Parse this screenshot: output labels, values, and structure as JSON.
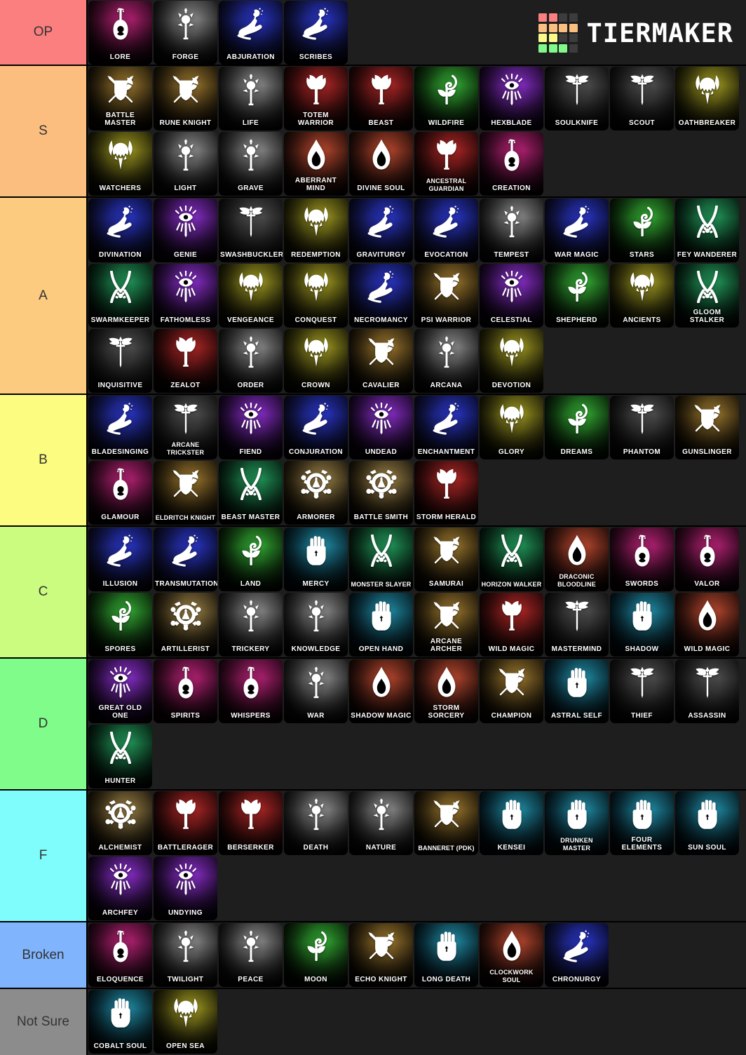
{
  "brand": {
    "name": "TIERMAKER",
    "logo_colors": [
      "#f98080",
      "#f98080",
      "#3c3c3c",
      "#3c3c3c",
      "#f9bf80",
      "#f9bf80",
      "#f9bf80",
      "#f9bf80",
      "#faf98a",
      "#faf98a",
      "#3c3c3c",
      "#3c3c3c",
      "#80f98a",
      "#80f98a",
      "#80f98a",
      "#3c3c3c"
    ]
  },
  "tiers": [
    {
      "label": "OP",
      "color": "#fc7f80",
      "items": [
        {
          "name": "Lore",
          "icon": "lute-icon",
          "c1": "#a31f69",
          "c2": "#1b0510"
        },
        {
          "name": "Forge",
          "icon": "mace-icon",
          "c1": "#7d7d7d",
          "c2": "#101010"
        },
        {
          "name": "Abjuration",
          "icon": "hand-icon",
          "c1": "#2631b4",
          "c2": "#0a0a1c"
        },
        {
          "name": "Scribes",
          "icon": "hand-icon",
          "c1": "#2631b4",
          "c2": "#0a0a1c"
        }
      ]
    },
    {
      "label": "S",
      "color": "#fcbe7f",
      "items": [
        {
          "name": "Battle Master",
          "icon": "shield-axe-icon",
          "c1": "#8a6a2a",
          "c2": "#120d04"
        },
        {
          "name": "Rune Knight",
          "icon": "shield-axe-icon",
          "c1": "#8a6a2a",
          "c2": "#120d04"
        },
        {
          "name": "Life",
          "icon": "mace-icon",
          "c1": "#7d7d7d",
          "c2": "#101010"
        },
        {
          "name": "Totem Warrior",
          "icon": "axe-icon",
          "c1": "#9e2323",
          "c2": "#140404"
        },
        {
          "name": "Beast",
          "icon": "axe-icon",
          "c1": "#9e2323",
          "c2": "#140404"
        },
        {
          "name": "Wildfire",
          "icon": "leaf-icon",
          "c1": "#2f9b2f",
          "c2": "#041204"
        },
        {
          "name": "Hexblade",
          "icon": "eye-icon",
          "c1": "#7b2ab5",
          "c2": "#0f0418"
        },
        {
          "name": "Soulknife",
          "icon": "dagger-icon",
          "c1": "#4a4a4a",
          "c2": "#0c0c0c"
        },
        {
          "name": "Scout",
          "icon": "dagger-icon",
          "c1": "#4a4a4a",
          "c2": "#0c0c0c"
        },
        {
          "name": "Oathbreaker",
          "icon": "helm-icon",
          "c1": "#8f8a1f",
          "c2": "#131204"
        },
        {
          "name": "Watchers",
          "icon": "helm-icon",
          "c1": "#8f8a1f",
          "c2": "#131204"
        },
        {
          "name": "Light",
          "icon": "mace-icon",
          "c1": "#7d7d7d",
          "c2": "#101010"
        },
        {
          "name": "Grave",
          "icon": "mace-icon",
          "c1": "#7d7d7d",
          "c2": "#101010"
        },
        {
          "name": "Aberrant Mind",
          "icon": "flame-icon",
          "c1": "#a3402a",
          "c2": "#160806"
        },
        {
          "name": "Divine Soul",
          "icon": "flame-icon",
          "c1": "#a3402a",
          "c2": "#160806"
        },
        {
          "name": "Ancestral Guardian",
          "icon": "axe-icon",
          "c1": "#9e2323",
          "c2": "#140404"
        },
        {
          "name": "Creation",
          "icon": "lute-icon",
          "c1": "#a31f69",
          "c2": "#1b0510"
        }
      ]
    },
    {
      "label": "A",
      "color": "#fccb80",
      "items": [
        {
          "name": "Divination",
          "icon": "hand-icon",
          "c1": "#2631b4",
          "c2": "#0a0a1c"
        },
        {
          "name": "Genie",
          "icon": "eye-icon",
          "c1": "#7b2ab5",
          "c2": "#0f0418"
        },
        {
          "name": "Swashbuckler",
          "icon": "dagger-icon",
          "c1": "#4a4a4a",
          "c2": "#0c0c0c"
        },
        {
          "name": "Redemption",
          "icon": "helm-icon",
          "c1": "#8f8a1f",
          "c2": "#131204"
        },
        {
          "name": "Graviturgy",
          "icon": "hand-icon",
          "c1": "#2631b4",
          "c2": "#0a0a1c"
        },
        {
          "name": "Evocation",
          "icon": "hand-icon",
          "c1": "#2631b4",
          "c2": "#0a0a1c"
        },
        {
          "name": "Tempest",
          "icon": "mace-icon",
          "c1": "#7d7d7d",
          "c2": "#101010"
        },
        {
          "name": "War Magic",
          "icon": "hand-icon",
          "c1": "#2631b4",
          "c2": "#0a0a1c"
        },
        {
          "name": "Stars",
          "icon": "leaf-icon",
          "c1": "#2f9b2f",
          "c2": "#041204"
        },
        {
          "name": "Fey Wanderer",
          "icon": "bow-icon",
          "c1": "#1f8a52",
          "c2": "#03120a"
        },
        {
          "name": "Swarmkeeper",
          "icon": "bow-icon",
          "c1": "#1f8a52",
          "c2": "#03120a"
        },
        {
          "name": "Fathomless",
          "icon": "eye-icon",
          "c1": "#7b2ab5",
          "c2": "#0f0418"
        },
        {
          "name": "Vengeance",
          "icon": "helm-icon",
          "c1": "#8f8a1f",
          "c2": "#131204"
        },
        {
          "name": "Conquest",
          "icon": "helm-icon",
          "c1": "#8f8a1f",
          "c2": "#131204"
        },
        {
          "name": "Necromancy",
          "icon": "hand-icon",
          "c1": "#2631b4",
          "c2": "#0a0a1c"
        },
        {
          "name": "Psi Warrior",
          "icon": "shield-axe-icon",
          "c1": "#8a6a2a",
          "c2": "#120d04"
        },
        {
          "name": "Celestial",
          "icon": "eye-icon",
          "c1": "#7b2ab5",
          "c2": "#0f0418"
        },
        {
          "name": "Shepherd",
          "icon": "leaf-icon",
          "c1": "#2f9b2f",
          "c2": "#041204"
        },
        {
          "name": "Ancients",
          "icon": "helm-icon",
          "c1": "#8f8a1f",
          "c2": "#131204"
        },
        {
          "name": "Gloom Stalker",
          "icon": "bow-icon",
          "c1": "#1f8a52",
          "c2": "#03120a"
        },
        {
          "name": "Inquisitive",
          "icon": "dagger-icon",
          "c1": "#4a4a4a",
          "c2": "#0c0c0c"
        },
        {
          "name": "Zealot",
          "icon": "axe-icon",
          "c1": "#9e2323",
          "c2": "#140404"
        },
        {
          "name": "Order",
          "icon": "mace-icon",
          "c1": "#7d7d7d",
          "c2": "#101010"
        },
        {
          "name": "Crown",
          "icon": "helm-icon",
          "c1": "#8f8a1f",
          "c2": "#131204"
        },
        {
          "name": "Cavalier",
          "icon": "shield-axe-icon",
          "c1": "#8a6a2a",
          "c2": "#120d04"
        },
        {
          "name": "Arcana",
          "icon": "mace-icon",
          "c1": "#7d7d7d",
          "c2": "#101010"
        },
        {
          "name": "Devotion",
          "icon": "helm-icon",
          "c1": "#8f8a1f",
          "c2": "#131204"
        }
      ]
    },
    {
      "label": "B",
      "color": "#fcfc80",
      "items": [
        {
          "name": "Bladesinging",
          "icon": "hand-icon",
          "c1": "#2631b4",
          "c2": "#0a0a1c"
        },
        {
          "name": "Arcane Trickster",
          "icon": "dagger-icon",
          "c1": "#4a4a4a",
          "c2": "#0c0c0c"
        },
        {
          "name": "Fiend",
          "icon": "eye-icon",
          "c1": "#7b2ab5",
          "c2": "#0f0418"
        },
        {
          "name": "Conjuration",
          "icon": "hand-icon",
          "c1": "#2631b4",
          "c2": "#0a0a1c"
        },
        {
          "name": "Undead",
          "icon": "eye-icon",
          "c1": "#7b2ab5",
          "c2": "#0f0418"
        },
        {
          "name": "Enchantment",
          "icon": "hand-icon",
          "c1": "#2631b4",
          "c2": "#0a0a1c"
        },
        {
          "name": "Glory",
          "icon": "helm-icon",
          "c1": "#8f8a1f",
          "c2": "#131204"
        },
        {
          "name": "Dreams",
          "icon": "leaf-icon",
          "c1": "#2f9b2f",
          "c2": "#041204"
        },
        {
          "name": "Phantom",
          "icon": "dagger-icon",
          "c1": "#4a4a4a",
          "c2": "#0c0c0c"
        },
        {
          "name": "Gunslinger",
          "icon": "shield-axe-icon",
          "c1": "#8a6a2a",
          "c2": "#120d04"
        },
        {
          "name": "Glamour",
          "icon": "lute-icon",
          "c1": "#a31f69",
          "c2": "#1b0510"
        },
        {
          "name": "Eldritch Knight",
          "icon": "shield-axe-icon",
          "c1": "#8a6a2a",
          "c2": "#120d04"
        },
        {
          "name": "Beast Master",
          "icon": "bow-icon",
          "c1": "#1f8a52",
          "c2": "#03120a"
        },
        {
          "name": "Armorer",
          "icon": "gear-icon",
          "c1": "#8a7340",
          "c2": "#151005"
        },
        {
          "name": "Battle Smith",
          "icon": "gear-icon",
          "c1": "#8a7340",
          "c2": "#151005"
        },
        {
          "name": "Storm Herald",
          "icon": "axe-icon",
          "c1": "#9e2323",
          "c2": "#140404"
        }
      ]
    },
    {
      "label": "C",
      "color": "#cbfc80",
      "items": [
        {
          "name": "Illusion",
          "icon": "hand-icon",
          "c1": "#2631b4",
          "c2": "#0a0a1c"
        },
        {
          "name": "Transmutation",
          "icon": "hand-icon",
          "c1": "#2631b4",
          "c2": "#0a0a1c"
        },
        {
          "name": "Land",
          "icon": "leaf-icon",
          "c1": "#2f9b2f",
          "c2": "#041204"
        },
        {
          "name": "Mercy",
          "icon": "fist-icon",
          "c1": "#1d7d94",
          "c2": "#03121a"
        },
        {
          "name": "Monster Slayer",
          "icon": "bow-icon",
          "c1": "#1f8a52",
          "c2": "#03120a"
        },
        {
          "name": "Samurai",
          "icon": "shield-axe-icon",
          "c1": "#8a6a2a",
          "c2": "#120d04"
        },
        {
          "name": "Horizon Walker",
          "icon": "bow-icon",
          "c1": "#1f8a52",
          "c2": "#03120a"
        },
        {
          "name": "Draconic Bloodline",
          "icon": "flame-icon",
          "c1": "#a3402a",
          "c2": "#160806"
        },
        {
          "name": "Swords",
          "icon": "lute-icon",
          "c1": "#a31f69",
          "c2": "#1b0510"
        },
        {
          "name": "Valor",
          "icon": "lute-icon",
          "c1": "#a31f69",
          "c2": "#1b0510"
        },
        {
          "name": "Spores",
          "icon": "leaf-icon",
          "c1": "#2f9b2f",
          "c2": "#041204"
        },
        {
          "name": "Artillerist",
          "icon": "gear-icon",
          "c1": "#8a7340",
          "c2": "#151005"
        },
        {
          "name": "Trickery",
          "icon": "mace-icon",
          "c1": "#7d7d7d",
          "c2": "#101010"
        },
        {
          "name": "Knowledge",
          "icon": "mace-icon",
          "c1": "#7d7d7d",
          "c2": "#101010"
        },
        {
          "name": "Open Hand",
          "icon": "fist-icon",
          "c1": "#1d7d94",
          "c2": "#03121a"
        },
        {
          "name": "Arcane Archer",
          "icon": "shield-axe-icon",
          "c1": "#8a6a2a",
          "c2": "#120d04"
        },
        {
          "name": "Wild Magic",
          "icon": "axe-icon",
          "c1": "#9e2323",
          "c2": "#140404"
        },
        {
          "name": "Mastermind",
          "icon": "dagger-icon",
          "c1": "#4a4a4a",
          "c2": "#0c0c0c"
        },
        {
          "name": "Shadow",
          "icon": "fist-icon",
          "c1": "#1d7d94",
          "c2": "#03121a"
        },
        {
          "name": "Wild Magic",
          "icon": "flame-icon",
          "c1": "#a3402a",
          "c2": "#160806"
        }
      ]
    },
    {
      "label": "D",
      "color": "#80fc8a",
      "items": [
        {
          "name": "Great Old One",
          "icon": "eye-icon",
          "c1": "#7b2ab5",
          "c2": "#0f0418"
        },
        {
          "name": "Spirits",
          "icon": "lute-icon",
          "c1": "#a31f69",
          "c2": "#1b0510"
        },
        {
          "name": "Whispers",
          "icon": "lute-icon",
          "c1": "#a31f69",
          "c2": "#1b0510"
        },
        {
          "name": "War",
          "icon": "mace-icon",
          "c1": "#7d7d7d",
          "c2": "#101010"
        },
        {
          "name": "Shadow Magic",
          "icon": "flame-icon",
          "c1": "#a3402a",
          "c2": "#160806"
        },
        {
          "name": "Storm Sorcery",
          "icon": "flame-icon",
          "c1": "#a3402a",
          "c2": "#160806"
        },
        {
          "name": "Champion",
          "icon": "shield-axe-icon",
          "c1": "#8a6a2a",
          "c2": "#120d04"
        },
        {
          "name": "Astral Self",
          "icon": "fist-icon",
          "c1": "#1d7d94",
          "c2": "#03121a"
        },
        {
          "name": "Thief",
          "icon": "dagger-icon",
          "c1": "#4a4a4a",
          "c2": "#0c0c0c"
        },
        {
          "name": "Assassin",
          "icon": "dagger-icon",
          "c1": "#4a4a4a",
          "c2": "#0c0c0c"
        },
        {
          "name": "Hunter",
          "icon": "bow-icon",
          "c1": "#1f8a52",
          "c2": "#03120a"
        }
      ]
    },
    {
      "label": "F",
      "color": "#7ffcfc",
      "items": [
        {
          "name": "Alchemist",
          "icon": "gear-icon",
          "c1": "#8a7340",
          "c2": "#151005"
        },
        {
          "name": "Battlerager",
          "icon": "axe-icon",
          "c1": "#9e2323",
          "c2": "#140404"
        },
        {
          "name": "Berserker",
          "icon": "axe-icon",
          "c1": "#9e2323",
          "c2": "#140404"
        },
        {
          "name": "Death",
          "icon": "mace-icon",
          "c1": "#7d7d7d",
          "c2": "#101010"
        },
        {
          "name": "Nature",
          "icon": "mace-icon",
          "c1": "#7d7d7d",
          "c2": "#101010"
        },
        {
          "name": "Banneret (PDK)",
          "icon": "shield-axe-icon",
          "c1": "#8a6a2a",
          "c2": "#120d04"
        },
        {
          "name": "Kensei",
          "icon": "fist-icon",
          "c1": "#1d7d94",
          "c2": "#03121a"
        },
        {
          "name": "Drunken Master",
          "icon": "fist-icon",
          "c1": "#1d7d94",
          "c2": "#03121a"
        },
        {
          "name": "Four Elements",
          "icon": "fist-icon",
          "c1": "#1d7d94",
          "c2": "#03121a"
        },
        {
          "name": "Sun Soul",
          "icon": "fist-icon",
          "c1": "#1d7d94",
          "c2": "#03121a"
        },
        {
          "name": "Archfey",
          "icon": "eye-icon",
          "c1": "#7b2ab5",
          "c2": "#0f0418"
        },
        {
          "name": "Undying",
          "icon": "eye-icon",
          "c1": "#7b2ab5",
          "c2": "#0f0418"
        }
      ]
    },
    {
      "label": "Broken",
      "color": "#80b4fc",
      "items": [
        {
          "name": "Eloquence",
          "icon": "lute-icon",
          "c1": "#a31f69",
          "c2": "#1b0510"
        },
        {
          "name": "Twilight",
          "icon": "mace-icon",
          "c1": "#7d7d7d",
          "c2": "#101010"
        },
        {
          "name": "Peace",
          "icon": "mace-icon",
          "c1": "#7d7d7d",
          "c2": "#101010"
        },
        {
          "name": "Moon",
          "icon": "leaf-icon",
          "c1": "#2f9b2f",
          "c2": "#041204"
        },
        {
          "name": "Echo Knight",
          "icon": "shield-axe-icon",
          "c1": "#8a6a2a",
          "c2": "#120d04"
        },
        {
          "name": "Long Death",
          "icon": "fist-icon",
          "c1": "#1d7d94",
          "c2": "#03121a"
        },
        {
          "name": "Clockwork Soul",
          "icon": "flame-icon",
          "c1": "#a3402a",
          "c2": "#160806"
        },
        {
          "name": "Chronurgy",
          "icon": "hand-icon",
          "c1": "#2631b4",
          "c2": "#0a0a1c"
        }
      ]
    },
    {
      "label": "Not Sure",
      "color": "#8c8c8c",
      "items": [
        {
          "name": "Cobalt Soul",
          "icon": "fist-icon",
          "c1": "#1d7d94",
          "c2": "#03121a"
        },
        {
          "name": "Open Sea",
          "icon": "helm-icon",
          "c1": "#8f8a1f",
          "c2": "#131204"
        }
      ]
    }
  ]
}
